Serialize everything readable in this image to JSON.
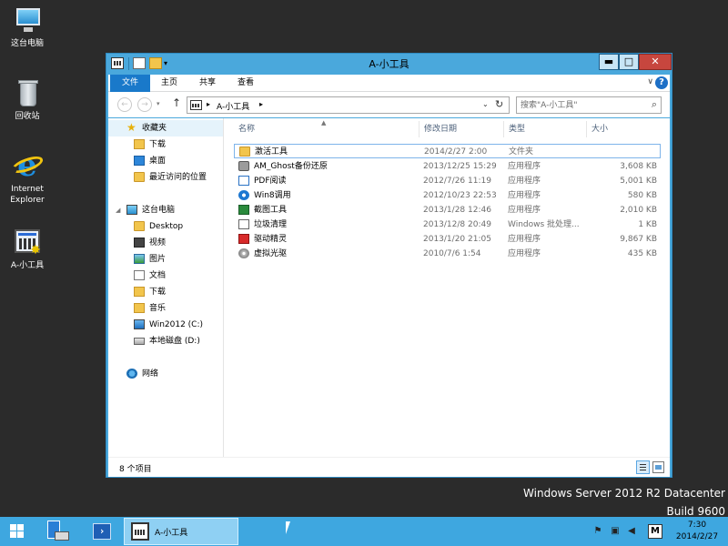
{
  "desktop": {
    "icons": [
      {
        "label": "这台电脑",
        "icon": "computer-icon"
      },
      {
        "label": "回收站",
        "icon": "recycle-bin-icon"
      },
      {
        "label": "Internet Explorer",
        "icon": "internet-explorer-icon"
      },
      {
        "label": "A-小工具",
        "icon": "app-folder-icon"
      }
    ]
  },
  "window": {
    "title": "A-小工具",
    "controls": {
      "minimize": "▬",
      "maximize": "□",
      "close": "✕"
    },
    "ribbon_tabs": [
      {
        "label": "文件",
        "active": true
      },
      {
        "label": "主页"
      },
      {
        "label": "共享"
      },
      {
        "label": "查看"
      }
    ],
    "ribbon_collapse": "∨",
    "help": "?",
    "address": {
      "path_segment": "A-小工具",
      "separator": "▸"
    },
    "search": {
      "placeholder": "搜索\"A-小工具\"",
      "value": ""
    },
    "nav_pane": {
      "favorites": {
        "label": "收藏夹",
        "items": [
          "下载",
          "桌面",
          "最近访问的位置"
        ]
      },
      "this_pc": {
        "label": "这台电脑",
        "items": [
          "Desktop",
          "视频",
          "图片",
          "文档",
          "下载",
          "音乐",
          "Win2012 (C:)",
          "本地磁盘 (D:)"
        ]
      },
      "network": {
        "label": "网络"
      }
    },
    "columns": {
      "name": "名称",
      "date": "修改日期",
      "type": "类型",
      "size": "大小"
    },
    "files": [
      {
        "name": "激活工具",
        "date": "2014/2/27 2:00",
        "type": "文件夹",
        "size": "",
        "icon": "folder-icon",
        "selected": true
      },
      {
        "name": "AM_Ghost备份还原",
        "date": "2013/12/25 15:29",
        "type": "应用程序",
        "size": "3,608 KB",
        "icon": "ghost-icon"
      },
      {
        "name": "PDF阅读",
        "date": "2012/7/26 11:19",
        "type": "应用程序",
        "size": "5,001 KB",
        "icon": "pdf-icon"
      },
      {
        "name": "Win8调用",
        "date": "2012/10/23 22:53",
        "type": "应用程序",
        "size": "580 KB",
        "icon": "win8-icon"
      },
      {
        "name": "截图工具",
        "date": "2013/1/28 12:46",
        "type": "应用程序",
        "size": "2,010 KB",
        "icon": "screenshot-icon"
      },
      {
        "name": "垃圾清理",
        "date": "2013/12/8 20:49",
        "type": "Windows 批处理...",
        "size": "1 KB",
        "icon": "batch-file-icon"
      },
      {
        "name": "驱动精灵",
        "date": "2013/1/20 21:05",
        "type": "应用程序",
        "size": "9,867 KB",
        "icon": "driver-icon"
      },
      {
        "name": "虚拟光驱",
        "date": "2010/7/6 1:54",
        "type": "应用程序",
        "size": "435 KB",
        "icon": "virtual-cd-icon"
      }
    ],
    "status": {
      "item_count": "8 个项目"
    }
  },
  "watermark": {
    "line1": "Windows Server 2012 R2 Datacenter",
    "line2": "Build 9600"
  },
  "taskbar": {
    "explorer_label": "A-小工具",
    "ime": "M",
    "time": "7:30",
    "date": "2014/2/27"
  }
}
